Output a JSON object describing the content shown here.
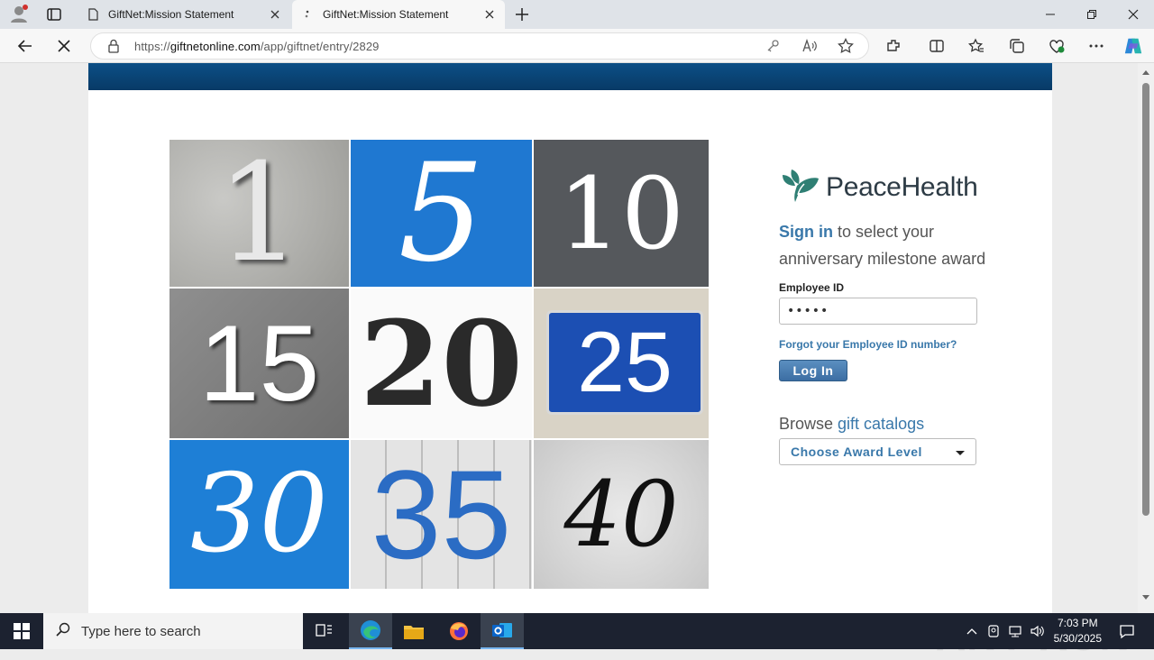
{
  "browser": {
    "tabs": [
      {
        "title": "GiftNet:Mission Statement"
      },
      {
        "title": "GiftNet:Mission Statement"
      }
    ],
    "address": {
      "prefix": "https://",
      "host": "giftnetonline.com",
      "path": "/app/giftnet/entry/2829"
    }
  },
  "tiles": [
    "1",
    "5",
    "10",
    "15",
    "20",
    "25",
    "30",
    "35",
    "40"
  ],
  "brand": {
    "name": "PeaceHealth",
    "color": "#2f7f74"
  },
  "signin": {
    "link": "Sign in",
    "rest": " to select your anniversary milestone award"
  },
  "form": {
    "employee_label": "Employee ID",
    "employee_value": "•••••",
    "forgot_link": "Forgot your Employee ID number?",
    "login_button": "Log In"
  },
  "browse": {
    "prefix": "Browse ",
    "link": "gift catalogs",
    "select_value": "Choose Award Level"
  },
  "watermark": "ANY RUN",
  "taskbar": {
    "search_placeholder": "Type here to search",
    "time": "7:03 PM",
    "date": "5/30/2025"
  }
}
